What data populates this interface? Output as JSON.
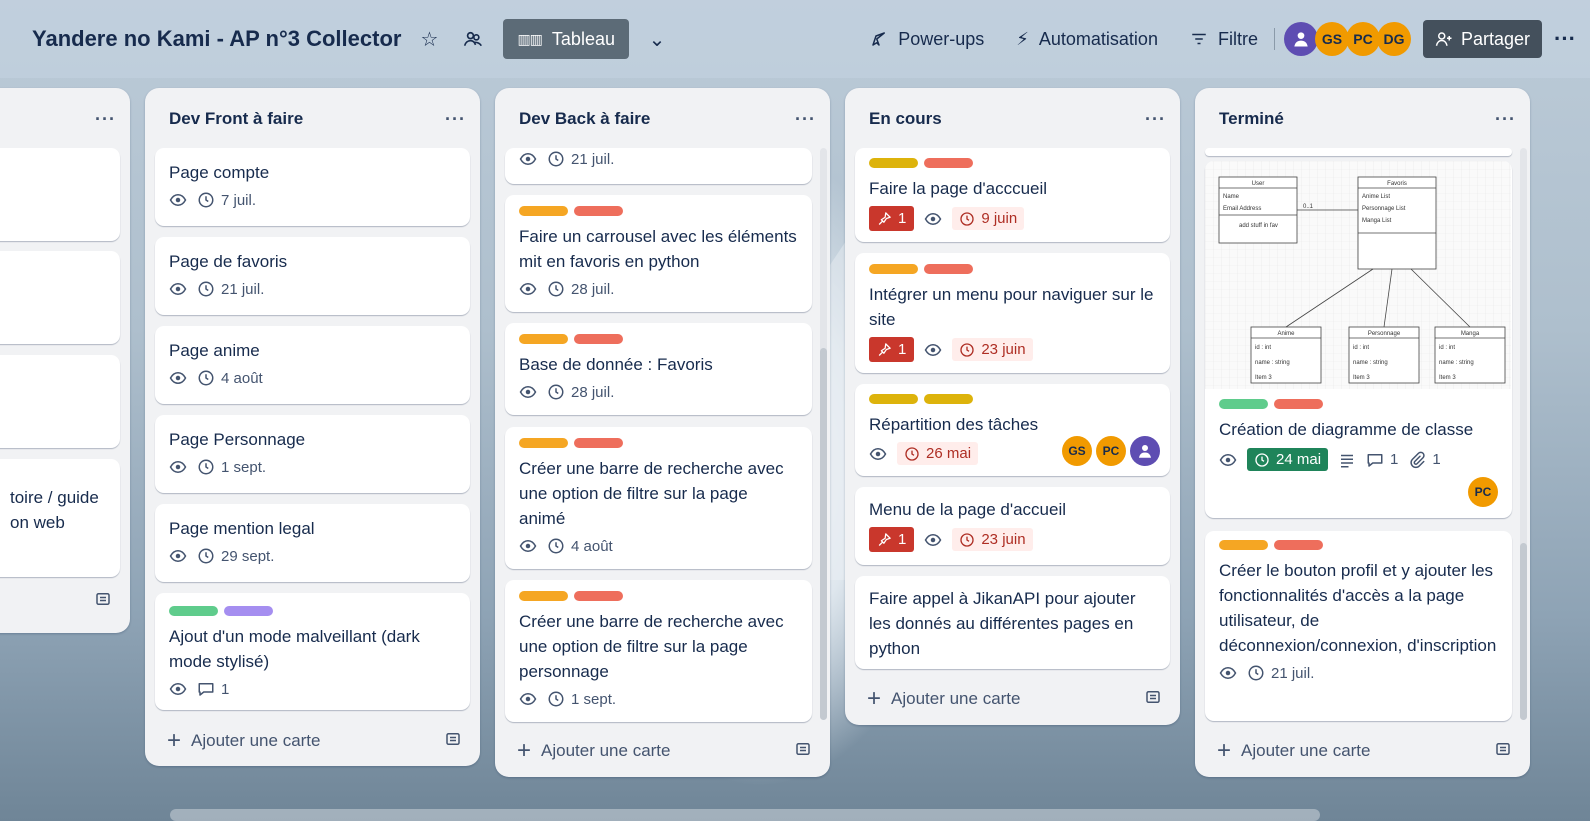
{
  "header": {
    "board_title": "Yandere no Kami - AP n°3 Collector",
    "view_label": "Tableau",
    "powerups_label": "Power-ups",
    "automation_label": "Automatisation",
    "filter_label": "Filtre",
    "members": [
      "GS",
      "PC",
      "DG"
    ],
    "share_label": "Partager"
  },
  "lists": {
    "left": {
      "card_text_1": "toire / guide",
      "card_text_2": "on web"
    },
    "front": {
      "title": "Dev Front à faire",
      "cards": [
        {
          "title": "Page compte",
          "date": "7 juil."
        },
        {
          "title": "Page de favoris",
          "date": "21 juil."
        },
        {
          "title": "Page anime",
          "date": "4 août"
        },
        {
          "title": "Page Personnage",
          "date": "1 sept."
        },
        {
          "title": "Page mention legal",
          "date": "29 sept."
        },
        {
          "title": "Ajout d'un mode malveillant (dark mode stylisé)",
          "comments": "1"
        }
      ],
      "add_label": "Ajouter une carte"
    },
    "back": {
      "title": "Dev Back à faire",
      "cards": [
        {
          "date": "21 juil."
        },
        {
          "title": "Faire un carrousel avec les éléments mit en favoris en python",
          "date": "28 juil."
        },
        {
          "title": "Base de donnée : Favoris",
          "date": "28 juil."
        },
        {
          "title": "Créer une barre de recherche avec une option de filtre sur la page animé",
          "date": "4 août"
        },
        {
          "title": "Créer une barre de recherche avec une option de filtre sur la page personnage",
          "date": "1 sept."
        }
      ],
      "add_label": "Ajouter une carte"
    },
    "encours": {
      "title": "En cours",
      "cards": [
        {
          "title": "Faire la page d'acccueil",
          "notif": "1",
          "date": "9 juin"
        },
        {
          "title": "Intégrer un menu pour naviguer sur le site",
          "notif": "1",
          "date": "23 juin"
        },
        {
          "title": "Répartition des tâches",
          "date": "26 mai",
          "members": [
            "GS",
            "PC"
          ]
        },
        {
          "title": "Menu de la page d'accueil",
          "notif": "1",
          "date": "23 juin"
        },
        {
          "title": "Faire appel à JikanAPI pour ajouter les donnés au différentes pages en python"
        }
      ],
      "add_label": "Ajouter une carte"
    },
    "done": {
      "title": "Terminé",
      "cards": [
        {
          "title": "Création de diagramme de classe",
          "date": "24 mai",
          "comments": "1",
          "attachments": "1",
          "member": "PC",
          "diagram": {
            "user_title": "User",
            "user_fields": [
              "Name",
              "Email Address"
            ],
            "user_method": "add stuff in fav",
            "mult": "0..1",
            "fav_title": "Favoris",
            "fav_fields": [
              "Anime List",
              "Personnage List",
              "Manga List"
            ],
            "anime_title": "Anime",
            "perso_title": "Personnage",
            "manga_title": "Manga",
            "sub_fields": [
              "id : int",
              "name : string",
              "Item 3"
            ]
          }
        },
        {
          "title": "Créer le bouton profil et y ajouter les fonctionnalités d'accès a la page utilisateur, de déconnexion/connexion, d'inscription",
          "date": "21 juil."
        }
      ],
      "add_label": "Ajouter une carte"
    }
  }
}
